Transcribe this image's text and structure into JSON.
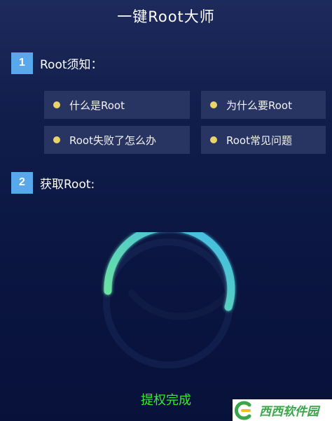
{
  "header": {
    "title": "一键Root大师"
  },
  "steps": [
    {
      "number": "1",
      "label": "Root须知："
    },
    {
      "number": "2",
      "label": "获取Root:"
    }
  ],
  "links": [
    {
      "label": "什么是Root"
    },
    {
      "label": "为什么要Root"
    },
    {
      "label": "Root失败了怎么办"
    },
    {
      "label": "Root常见问题"
    }
  ],
  "progress": {
    "fraction": 1.0
  },
  "status": {
    "text": "提权完成"
  },
  "watermark": {
    "text": "西西软件园"
  },
  "colors": {
    "accent": "#5aa8ec",
    "dot": "#e9d46a",
    "ring_start": "#3fb7ec",
    "ring_end": "#6fe69b",
    "status": "#37e837"
  }
}
